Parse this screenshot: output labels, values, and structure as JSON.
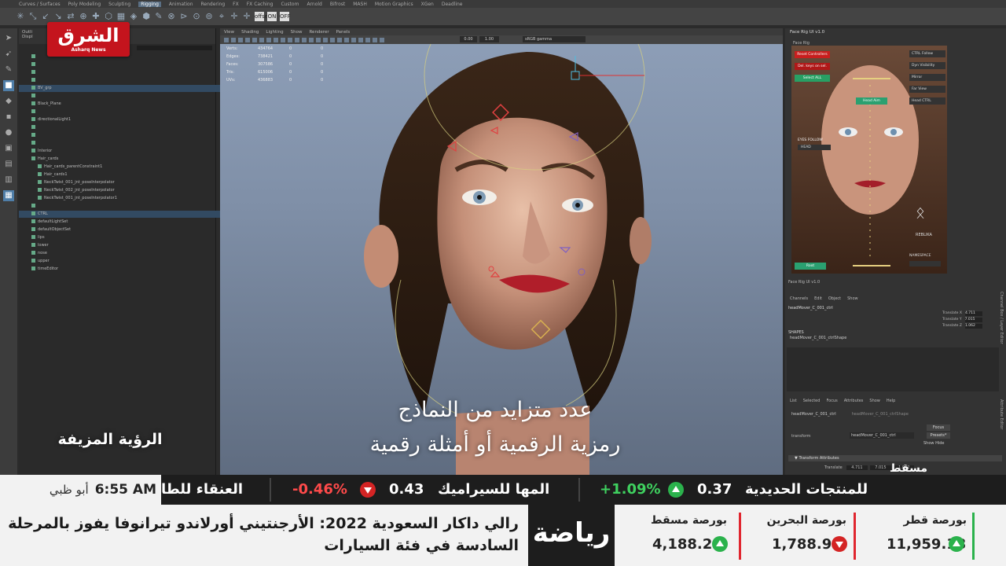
{
  "maya": {
    "menu_tabs": [
      "Curves / Surfaces",
      "Poly Modeling",
      "Sculpting",
      "Rigging",
      "Animation",
      "Rendering",
      "FX",
      "FX Caching",
      "Custom",
      "Arnold",
      "Bifrost",
      "MASH",
      "Motion Graphics",
      "XGen",
      "Deadline"
    ],
    "active_tab": "Rigging",
    "shelf_labels": [
      "offset",
      "ON",
      "OFF"
    ]
  },
  "outliner": {
    "title": "Outli",
    "subtitle": "Displ",
    "items": [
      {
        "label": "",
        "state": "dim"
      },
      {
        "label": "",
        "state": "dim"
      },
      {
        "label": "",
        "state": "dim"
      },
      {
        "label": "",
        "state": "dim"
      },
      {
        "label": "BV_grp",
        "state": "selected"
      },
      {
        "label": "",
        "state": "dim"
      },
      {
        "label": "Black_Plane",
        "state": "normal"
      },
      {
        "label": "",
        "state": "dim"
      },
      {
        "label": "directionalLight1",
        "state": "normal"
      },
      {
        "label": "",
        "state": "dim"
      },
      {
        "label": "",
        "state": "dim"
      },
      {
        "label": "",
        "state": "dim"
      },
      {
        "label": "Interior",
        "state": "normal"
      },
      {
        "label": "Hair_cards",
        "state": "normal"
      },
      {
        "label": "Hair_cards_parentConstraint1",
        "state": "normal"
      },
      {
        "label": "Hair_cards1",
        "state": "normal"
      },
      {
        "label": "NeckTwist_001_jnt_poseInterpolator",
        "state": "normal"
      },
      {
        "label": "NeckTwist_002_jnt_poseInterpolator",
        "state": "normal"
      },
      {
        "label": "NeckTwist_001_jnt_poseInterpolator1",
        "state": "normal"
      },
      {
        "label": "",
        "state": "dim"
      },
      {
        "label": "CTRL",
        "state": "selected"
      },
      {
        "label": "defaultLightSet",
        "state": "normal"
      },
      {
        "label": "defaultObjectSet",
        "state": "normal"
      },
      {
        "label": "lips",
        "state": "normal"
      },
      {
        "label": "lower",
        "state": "normal"
      },
      {
        "label": "nose",
        "state": "normal"
      },
      {
        "label": "upper",
        "state": "normal"
      },
      {
        "label": "timeEditor",
        "state": "normal"
      }
    ]
  },
  "viewport": {
    "menu": [
      "View",
      "Shading",
      "Lighting",
      "Show",
      "Renderer",
      "Panels"
    ],
    "field1": "0.00",
    "field2": "1.00",
    "colorspace": "sRGB gamma",
    "hud": [
      {
        "label": "Verts:",
        "v1": "434764",
        "v2": "0",
        "v3": "0"
      },
      {
        "label": "Edges:",
        "v1": "738421",
        "v2": "0",
        "v3": "0"
      },
      {
        "label": "Faces:",
        "v1": "307586",
        "v2": "0",
        "v3": "0"
      },
      {
        "label": "Tris:",
        "v1": "615006",
        "v2": "0",
        "v3": "0"
      },
      {
        "label": "UVs:",
        "v1": "436883",
        "v2": "0",
        "v3": "0"
      }
    ]
  },
  "face_rig": {
    "title": "Face Rig UI v1.0",
    "tab": "Face Rig",
    "btn_reset": "Reset Controllers",
    "btn_del_keys": "Del. keys on sel.",
    "btn_select_all": "Select ALL",
    "chk_ctrl_follow": "CTRL Follow",
    "chk_dyn_visibility": "Dyn Visibility",
    "chk_mirror": "Mirror",
    "chk_far_view": "Far View",
    "chk_head_ctrl": "Head CTRL",
    "head_aim": "Head Aim",
    "eyes_follow": "EYES FOLLOW",
    "eyes_mode": "HEAD",
    "brand": "REBLIKA",
    "namespace": "NAMESPACE",
    "root": "Root",
    "footer": "Face Rig UI v1.0"
  },
  "channel_box": {
    "menu": [
      "Channels",
      "Edit",
      "Object",
      "Show"
    ],
    "node": "headMover_C_001_ctrl",
    "attrs": [
      {
        "label": "Translate X",
        "value": "4.711"
      },
      {
        "label": "Translate Y",
        "value": "7.015"
      },
      {
        "label": "Translate Z",
        "value": "1.062"
      }
    ],
    "shapes_label": "SHAPES",
    "shape_node": "headMover_C_001_ctrlShape",
    "side_tab1": "Channel Box / Layer Editor",
    "side_tab2": "Attribute Editor"
  },
  "attr_editor": {
    "menu": [
      "List",
      "Selected",
      "Focus",
      "Attributes",
      "Show",
      "Help"
    ],
    "tab1": "headMover_C_001_ctrl",
    "tab2": "headMover_C_001_ctrlShape",
    "transform_label": "transform",
    "transform_name": "headMover_C_001_ctrl",
    "focus": "Focus",
    "presets": "Presets*",
    "show": "Show",
    "hide": "Hide",
    "section": "Transform Attributes",
    "translate_label": "Translate",
    "translate_values": [
      "4.711",
      "7.015",
      "1.062"
    ]
  },
  "brand": {
    "logo_ar": "الشرق",
    "logo_en": "Asharq News",
    "accent": "#c4141d"
  },
  "captions": {
    "program": "الرؤية المزيفة",
    "line1": "عدد متزايد من النماذج",
    "line2": "رمزية الرقمية أو أمثلة رقمية"
  },
  "ticker": {
    "time": "6:55 AM",
    "city": "أبو ظبي",
    "muscat": "مسقط",
    "items": [
      {
        "name": "العنقاء للطا",
        "value": "",
        "change": "",
        "dir": ""
      },
      {
        "name": "المها للسيراميك",
        "value": "0.43",
        "change": "-0.46%",
        "dir": "down"
      },
      {
        "name": "للمنتجات الحديدية",
        "value": "0.37",
        "change": "+1.09%",
        "dir": "up"
      }
    ]
  },
  "bottom": {
    "headline": "رالي داكار السعودية 2022: الأرجنتيني أورلاندو تيرانوفا يفوز بالمرحلة السادسة في فئة السيارات",
    "section_tag": "رياضة",
    "markets": [
      {
        "name": "بورصة مسقط",
        "value": "4,188.23",
        "dir": "up"
      },
      {
        "name": "بورصة البحرين",
        "value": "1,788.93",
        "dir": "down"
      },
      {
        "name": "بورصة قطر",
        "value": "11,959.13",
        "dir": "up"
      }
    ],
    "colors": {
      "up": "#2bb24c",
      "down": "#d42424",
      "bar": "#e0262f"
    }
  }
}
